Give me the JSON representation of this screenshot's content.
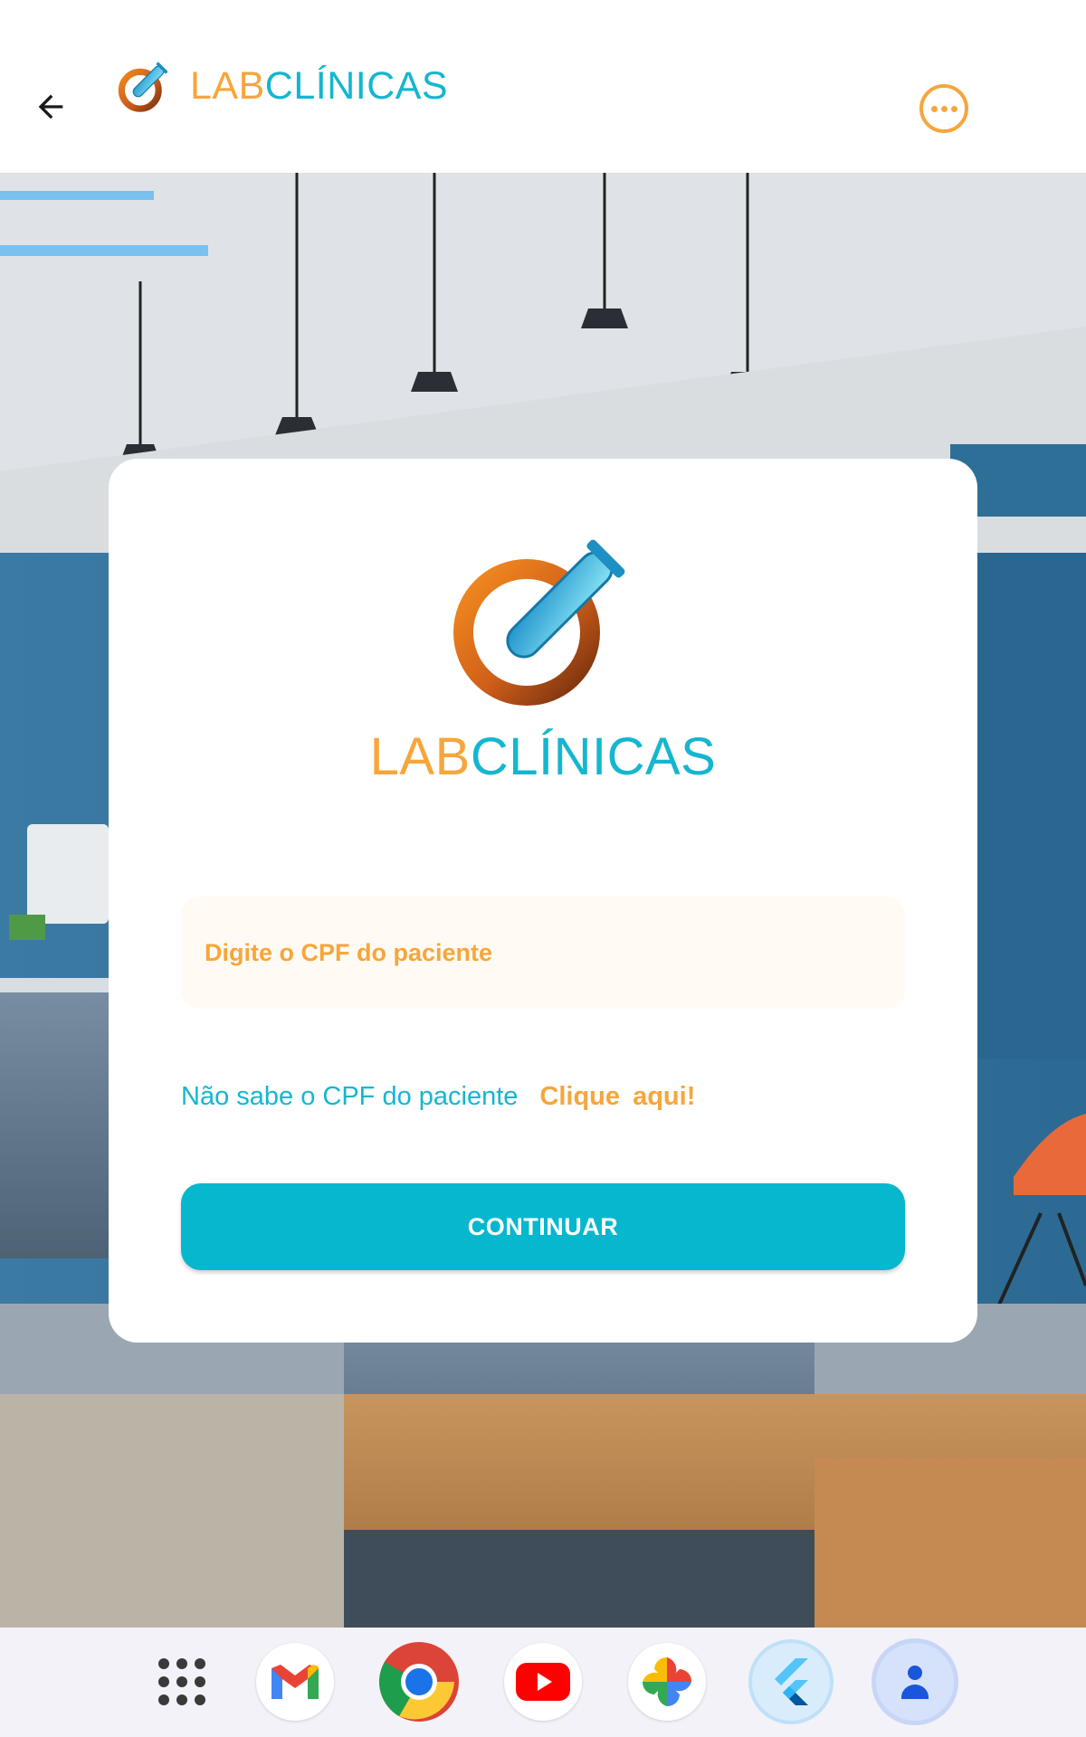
{
  "header": {
    "back_icon": "arrow-left-icon",
    "brand_lab": "LAB",
    "brand_clinicas": "CLÍNICAS",
    "more_icon": "more-horizontal-icon"
  },
  "card": {
    "brand_lab": "LAB",
    "brand_clinicas": "CLÍNICAS",
    "cpf_input": {
      "value": "",
      "placeholder": "Digite o CPF do paciente"
    },
    "help_text": "Não sabe o CPF do paciente",
    "help_link": "Clique  aqui!",
    "continue_label": "CONTINUAR"
  },
  "dock": {
    "items": [
      {
        "name": "app-launcher",
        "icon": "grid-icon"
      },
      {
        "name": "gmail",
        "icon": "gmail-icon"
      },
      {
        "name": "chrome",
        "icon": "chrome-icon"
      },
      {
        "name": "youtube",
        "icon": "youtube-icon"
      },
      {
        "name": "photos",
        "icon": "photos-icon"
      },
      {
        "name": "flutter",
        "icon": "flutter-icon"
      },
      {
        "name": "account",
        "icon": "person-icon"
      }
    ]
  },
  "colors": {
    "brand_orange": "#f6a63b",
    "brand_teal": "#15b6cf",
    "button": "#06b7ce",
    "wall_blue": "#2f6f96"
  }
}
